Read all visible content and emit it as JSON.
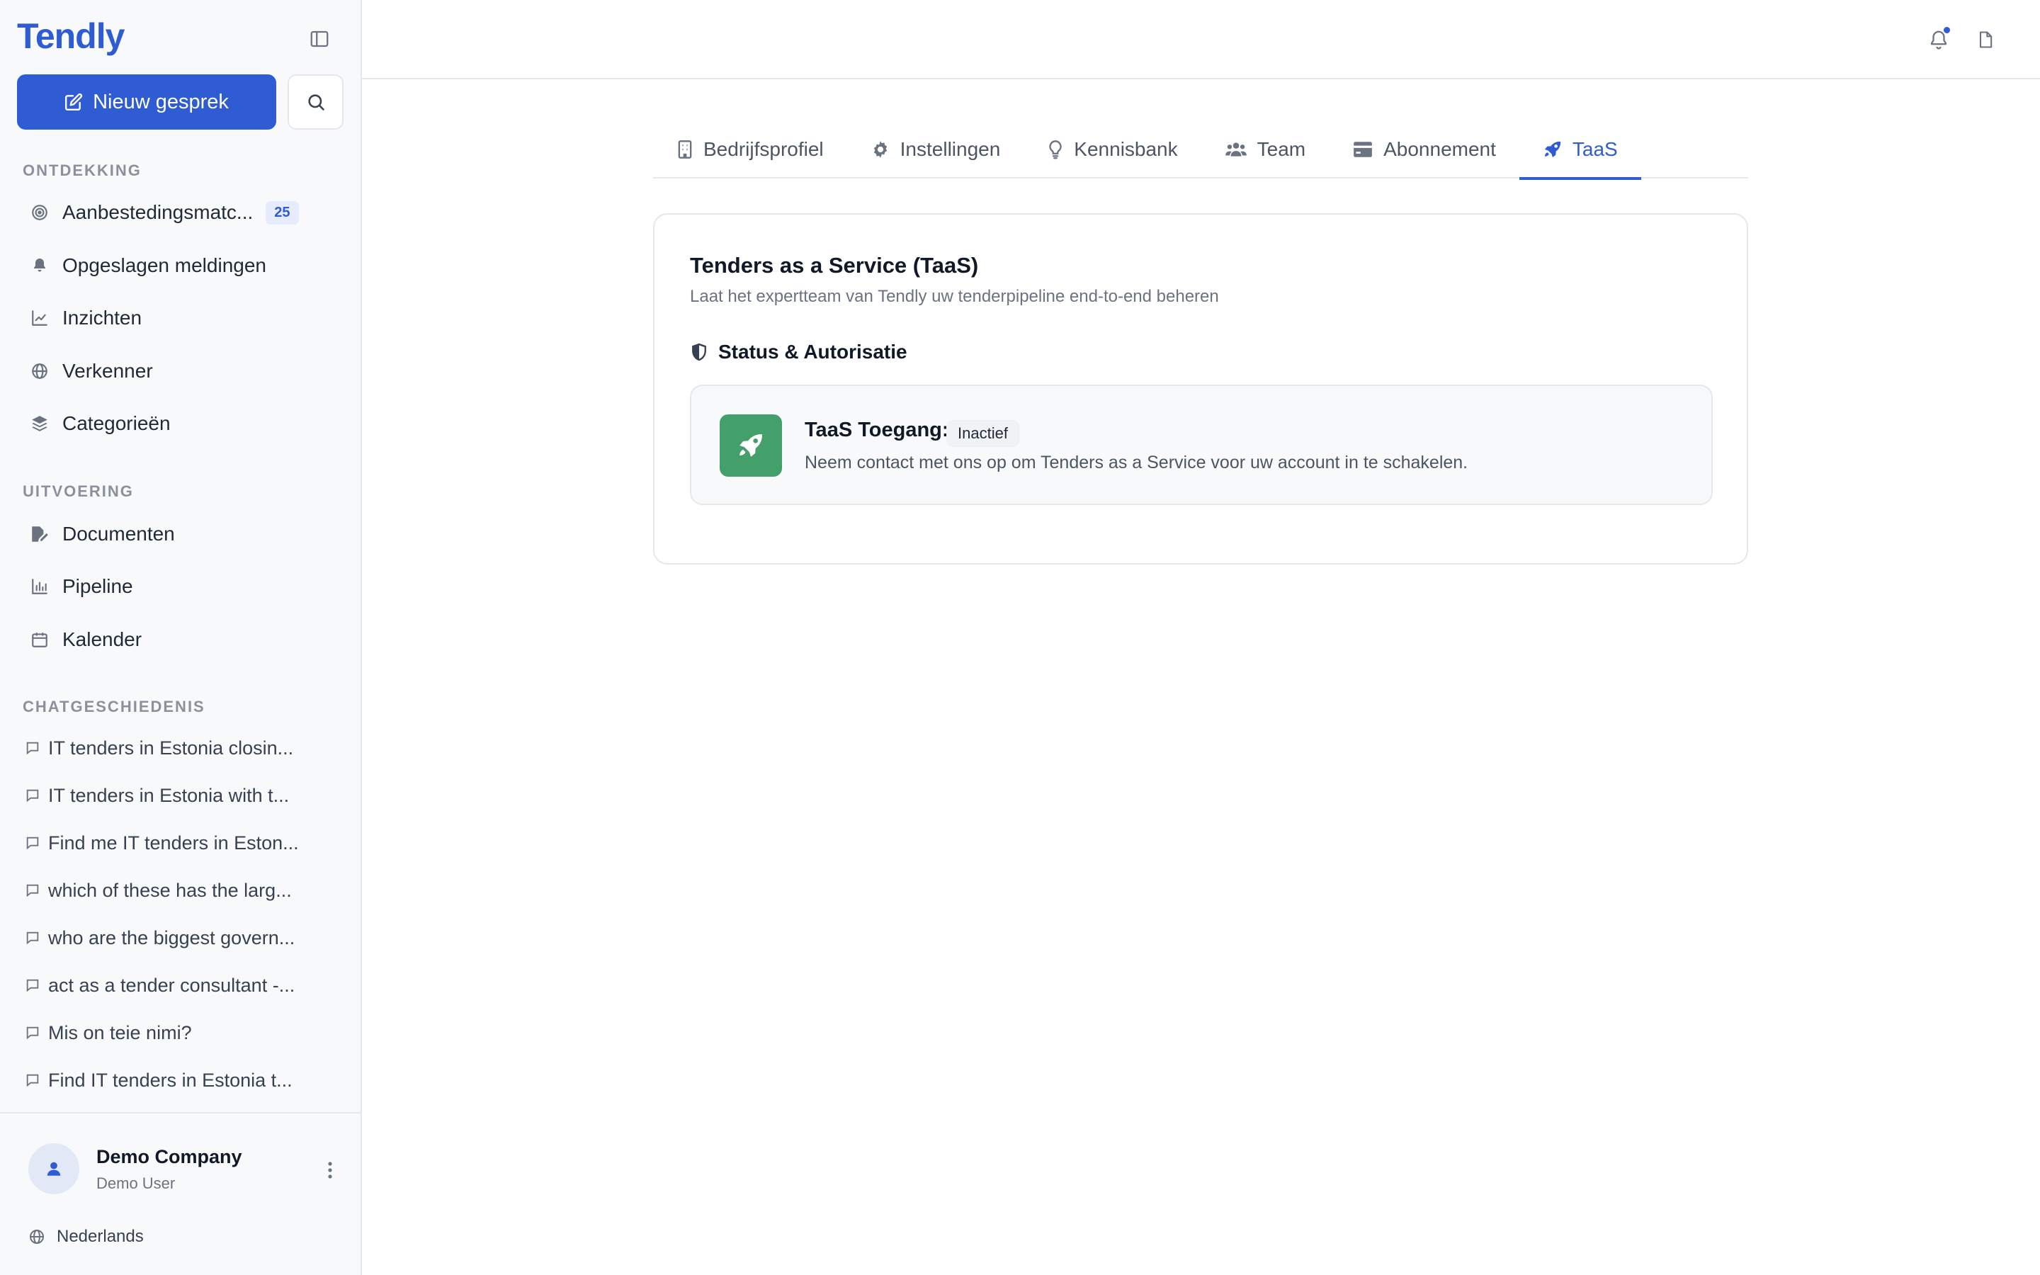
{
  "app": {
    "brand": "Tendly"
  },
  "sidebar": {
    "new_chat_label": "Nieuw gesprek",
    "sections": {
      "discover": "ONTDEKKING",
      "execute": "UITVOERING",
      "history": "CHATGESCHIEDENIS"
    },
    "discover_items": [
      {
        "label": "Aanbestedingsmatc...",
        "icon": "target-icon",
        "badge": "25"
      },
      {
        "label": "Opgeslagen meldingen",
        "icon": "bell-icon"
      },
      {
        "label": "Inzichten",
        "icon": "chart-line-icon"
      },
      {
        "label": "Verkenner",
        "icon": "globe-icon"
      },
      {
        "label": "Categorieën",
        "icon": "layers-icon"
      }
    ],
    "execute_items": [
      {
        "label": "Documenten",
        "icon": "file-edit-icon"
      },
      {
        "label": "Pipeline",
        "icon": "bar-chart-icon"
      },
      {
        "label": "Kalender",
        "icon": "calendar-icon"
      }
    ],
    "chats": [
      "IT tenders in Estonia closin...",
      "IT tenders in Estonia with t...",
      "Find me IT tenders in Eston...",
      "which of these has the larg...",
      "who are the biggest govern...",
      "act as a tender consultant -...",
      "Mis on teie nimi?",
      "Find IT tenders in Estonia t..."
    ],
    "user": {
      "company": "Demo Company",
      "name": "Demo User"
    },
    "language": "Nederlands"
  },
  "tabs": [
    {
      "label": "Bedrijfsprofiel",
      "icon": "building-icon",
      "active": false
    },
    {
      "label": "Instellingen",
      "icon": "gear-icon",
      "active": false
    },
    {
      "label": "Kennisbank",
      "icon": "lightbulb-icon",
      "active": false
    },
    {
      "label": "Team",
      "icon": "users-icon",
      "active": false
    },
    {
      "label": "Abonnement",
      "icon": "credit-card-icon",
      "active": false
    },
    {
      "label": "TaaS",
      "icon": "rocket-icon",
      "active": true
    }
  ],
  "card": {
    "title": "Tenders as a Service (TaaS)",
    "subtitle": "Laat het expertteam van Tendly uw tenderpipeline end-to-end beheren",
    "status_heading": "Status & Autorisatie",
    "access_label": "TaaS Toegang:",
    "access_status": "Inactief",
    "access_description": "Neem contact met ons op om Tenders as a Service voor uw account in te schakelen."
  },
  "colors": {
    "accent": "#2f5bd3",
    "rocket_tile": "#44a06a",
    "sidebar_bg": "#f8f9fb"
  }
}
